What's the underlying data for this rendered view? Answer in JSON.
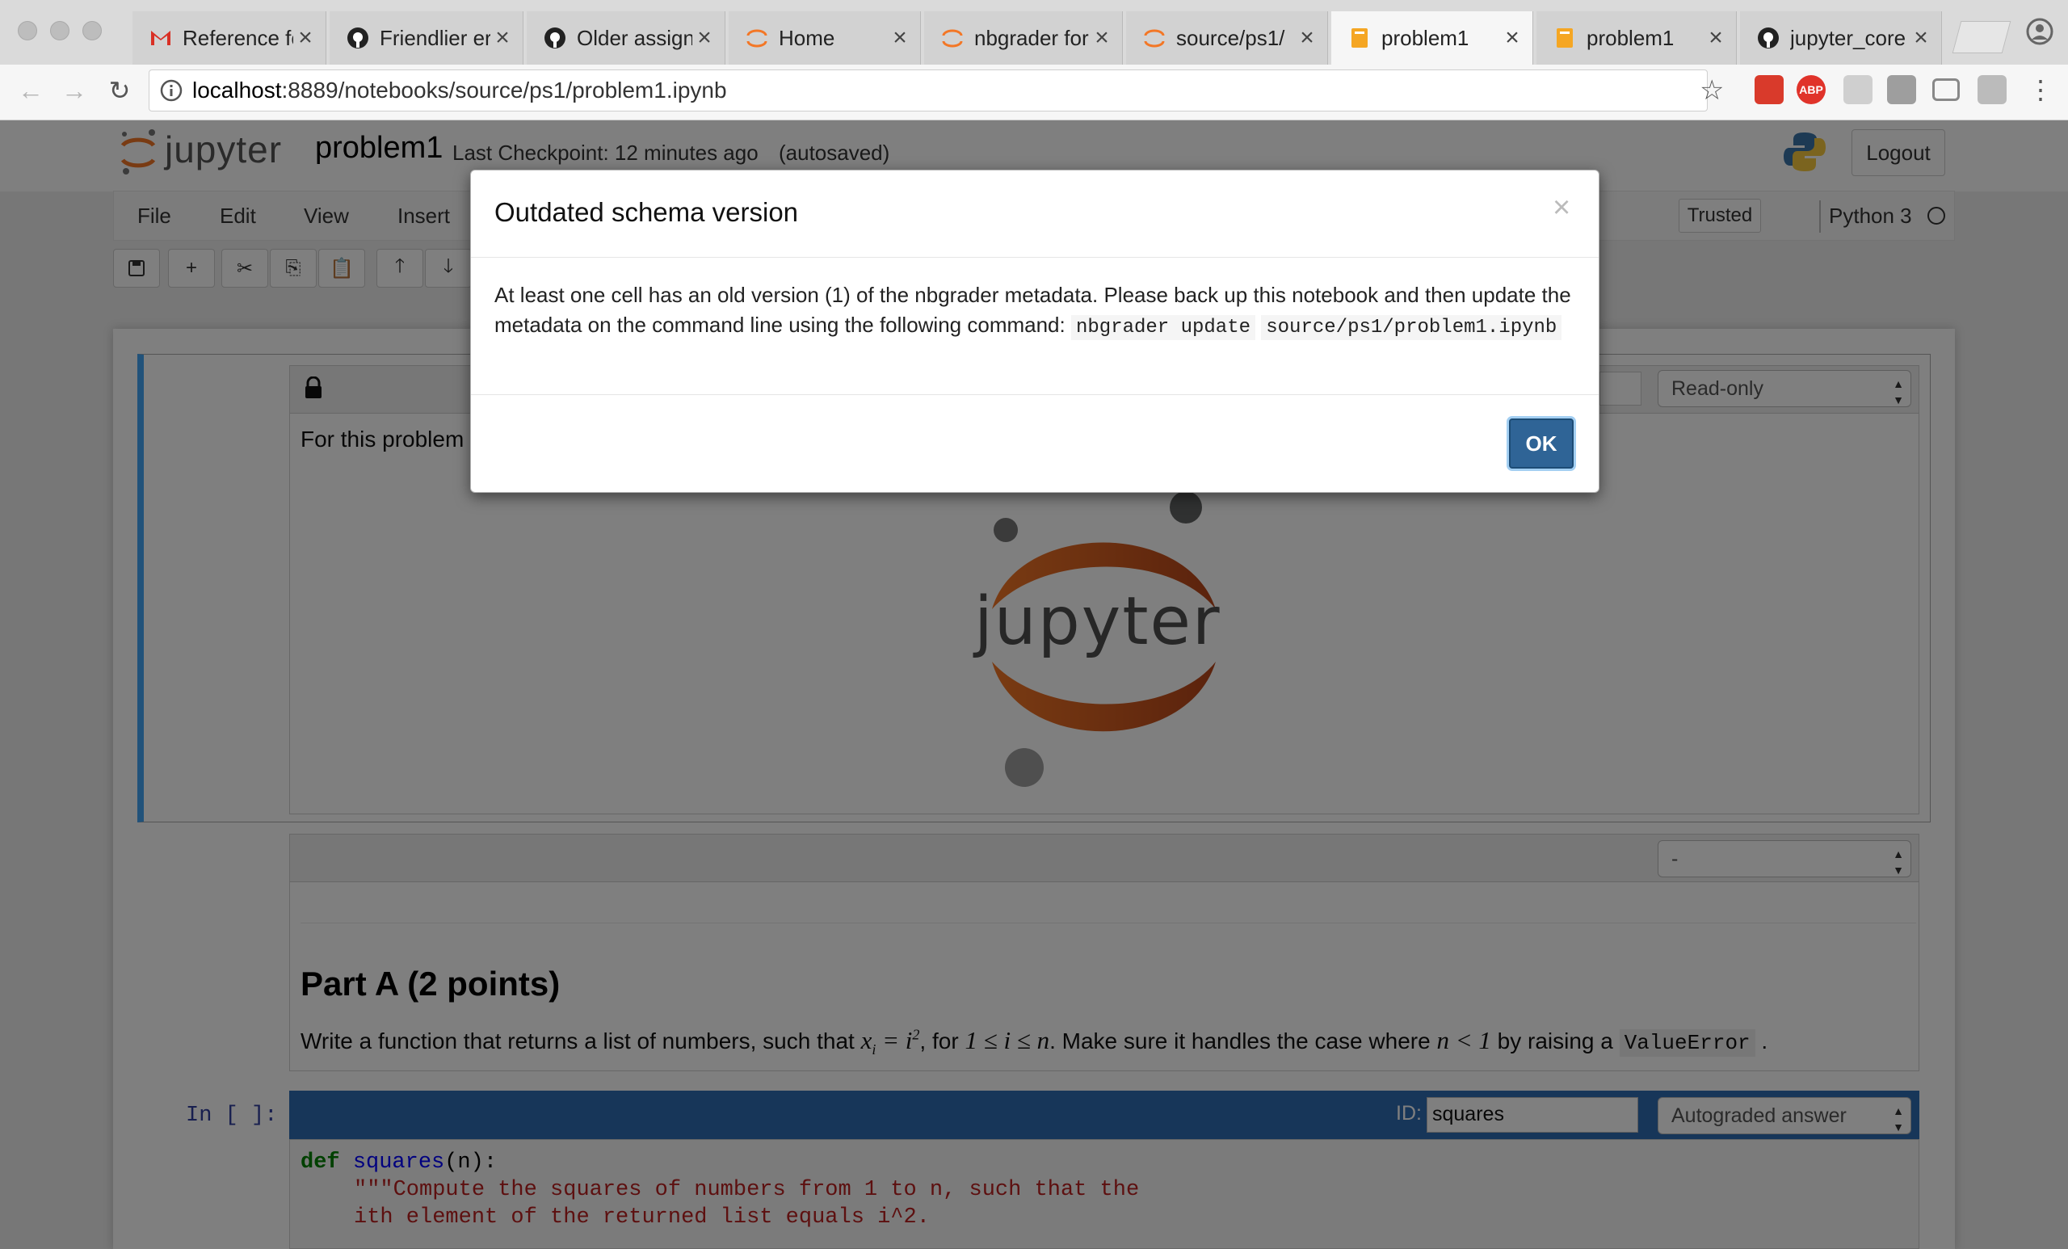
{
  "browser": {
    "tabs": [
      {
        "label": "Reference fo",
        "icon": "gmail-icon"
      },
      {
        "label": "Friendlier err",
        "icon": "github-icon"
      },
      {
        "label": "Older assign",
        "icon": "github-icon"
      },
      {
        "label": "Home",
        "icon": "jupyter-icon"
      },
      {
        "label": "nbgrader for",
        "icon": "jupyter-icon"
      },
      {
        "label": "source/ps1/",
        "icon": "jupyter-icon"
      },
      {
        "label": "problem1",
        "icon": "notebook-icon"
      },
      {
        "label": "problem1",
        "icon": "notebook-icon"
      },
      {
        "label": "jupyter_core",
        "icon": "github-icon"
      }
    ],
    "active_tab": 6,
    "url_host": "localhost",
    "url_rest": ":8889/notebooks/source/ps1/problem1.ipynb",
    "extensions": {
      "abp_label": "ABP"
    }
  },
  "jupyter": {
    "logo_text": "jupyter",
    "notebook_name": "problem1",
    "checkpoint": "Last Checkpoint: 12 minutes ago",
    "autosave": "(autosaved)",
    "logout_label": "Logout",
    "menu": [
      "File",
      "Edit",
      "View",
      "Insert"
    ],
    "trusted_label": "Trusted",
    "kernel_label": "Python 3",
    "toolbar_icons": [
      "save-icon",
      "plus-icon",
      "cut-icon",
      "copy-icon",
      "paste-icon",
      "arrow-up-icon",
      "arrow-down-icon"
    ]
  },
  "cells": {
    "cell1": {
      "select_value": "Read-only",
      "text": "For this problem",
      "logo_text": "jupyter"
    },
    "cell2": {
      "select_value": "-",
      "heading": "Part A (2 points)",
      "text_before": "Write a function that returns a list of numbers, such that ",
      "math1": "x",
      "math1_sub": "i",
      "math1_eq": " = i",
      "math1_sup": "2",
      "text_mid": ", for ",
      "math2": "1 ≤ i ≤ n",
      "text_mid2": ". Make sure it handles the case where ",
      "math3": "n < 1",
      "text_mid3": " by raising a ",
      "code": "ValueError",
      "text_end": " ."
    },
    "cell3": {
      "prompt": "In [ ]:",
      "id_label": "ID:",
      "id_value": "squares",
      "select_value": "Autograded answer",
      "code_def": "def",
      "code_fn": "squares",
      "code_args": "(n):",
      "code_line2": "\"\"\"Compute the squares of numbers from 1 to n, such that the",
      "code_line3": "ith element of the returned list equals i^2."
    }
  },
  "modal": {
    "title": "Outdated schema version",
    "close": "×",
    "body_text": "At least one cell has an old version (1) of the nbgrader metadata. Please back up this notebook and then update the metadata on the command line using the following command: ",
    "command_1": "nbgrader update",
    "command_2": "source/ps1/problem1.ipynb",
    "ok_label": "OK"
  }
}
